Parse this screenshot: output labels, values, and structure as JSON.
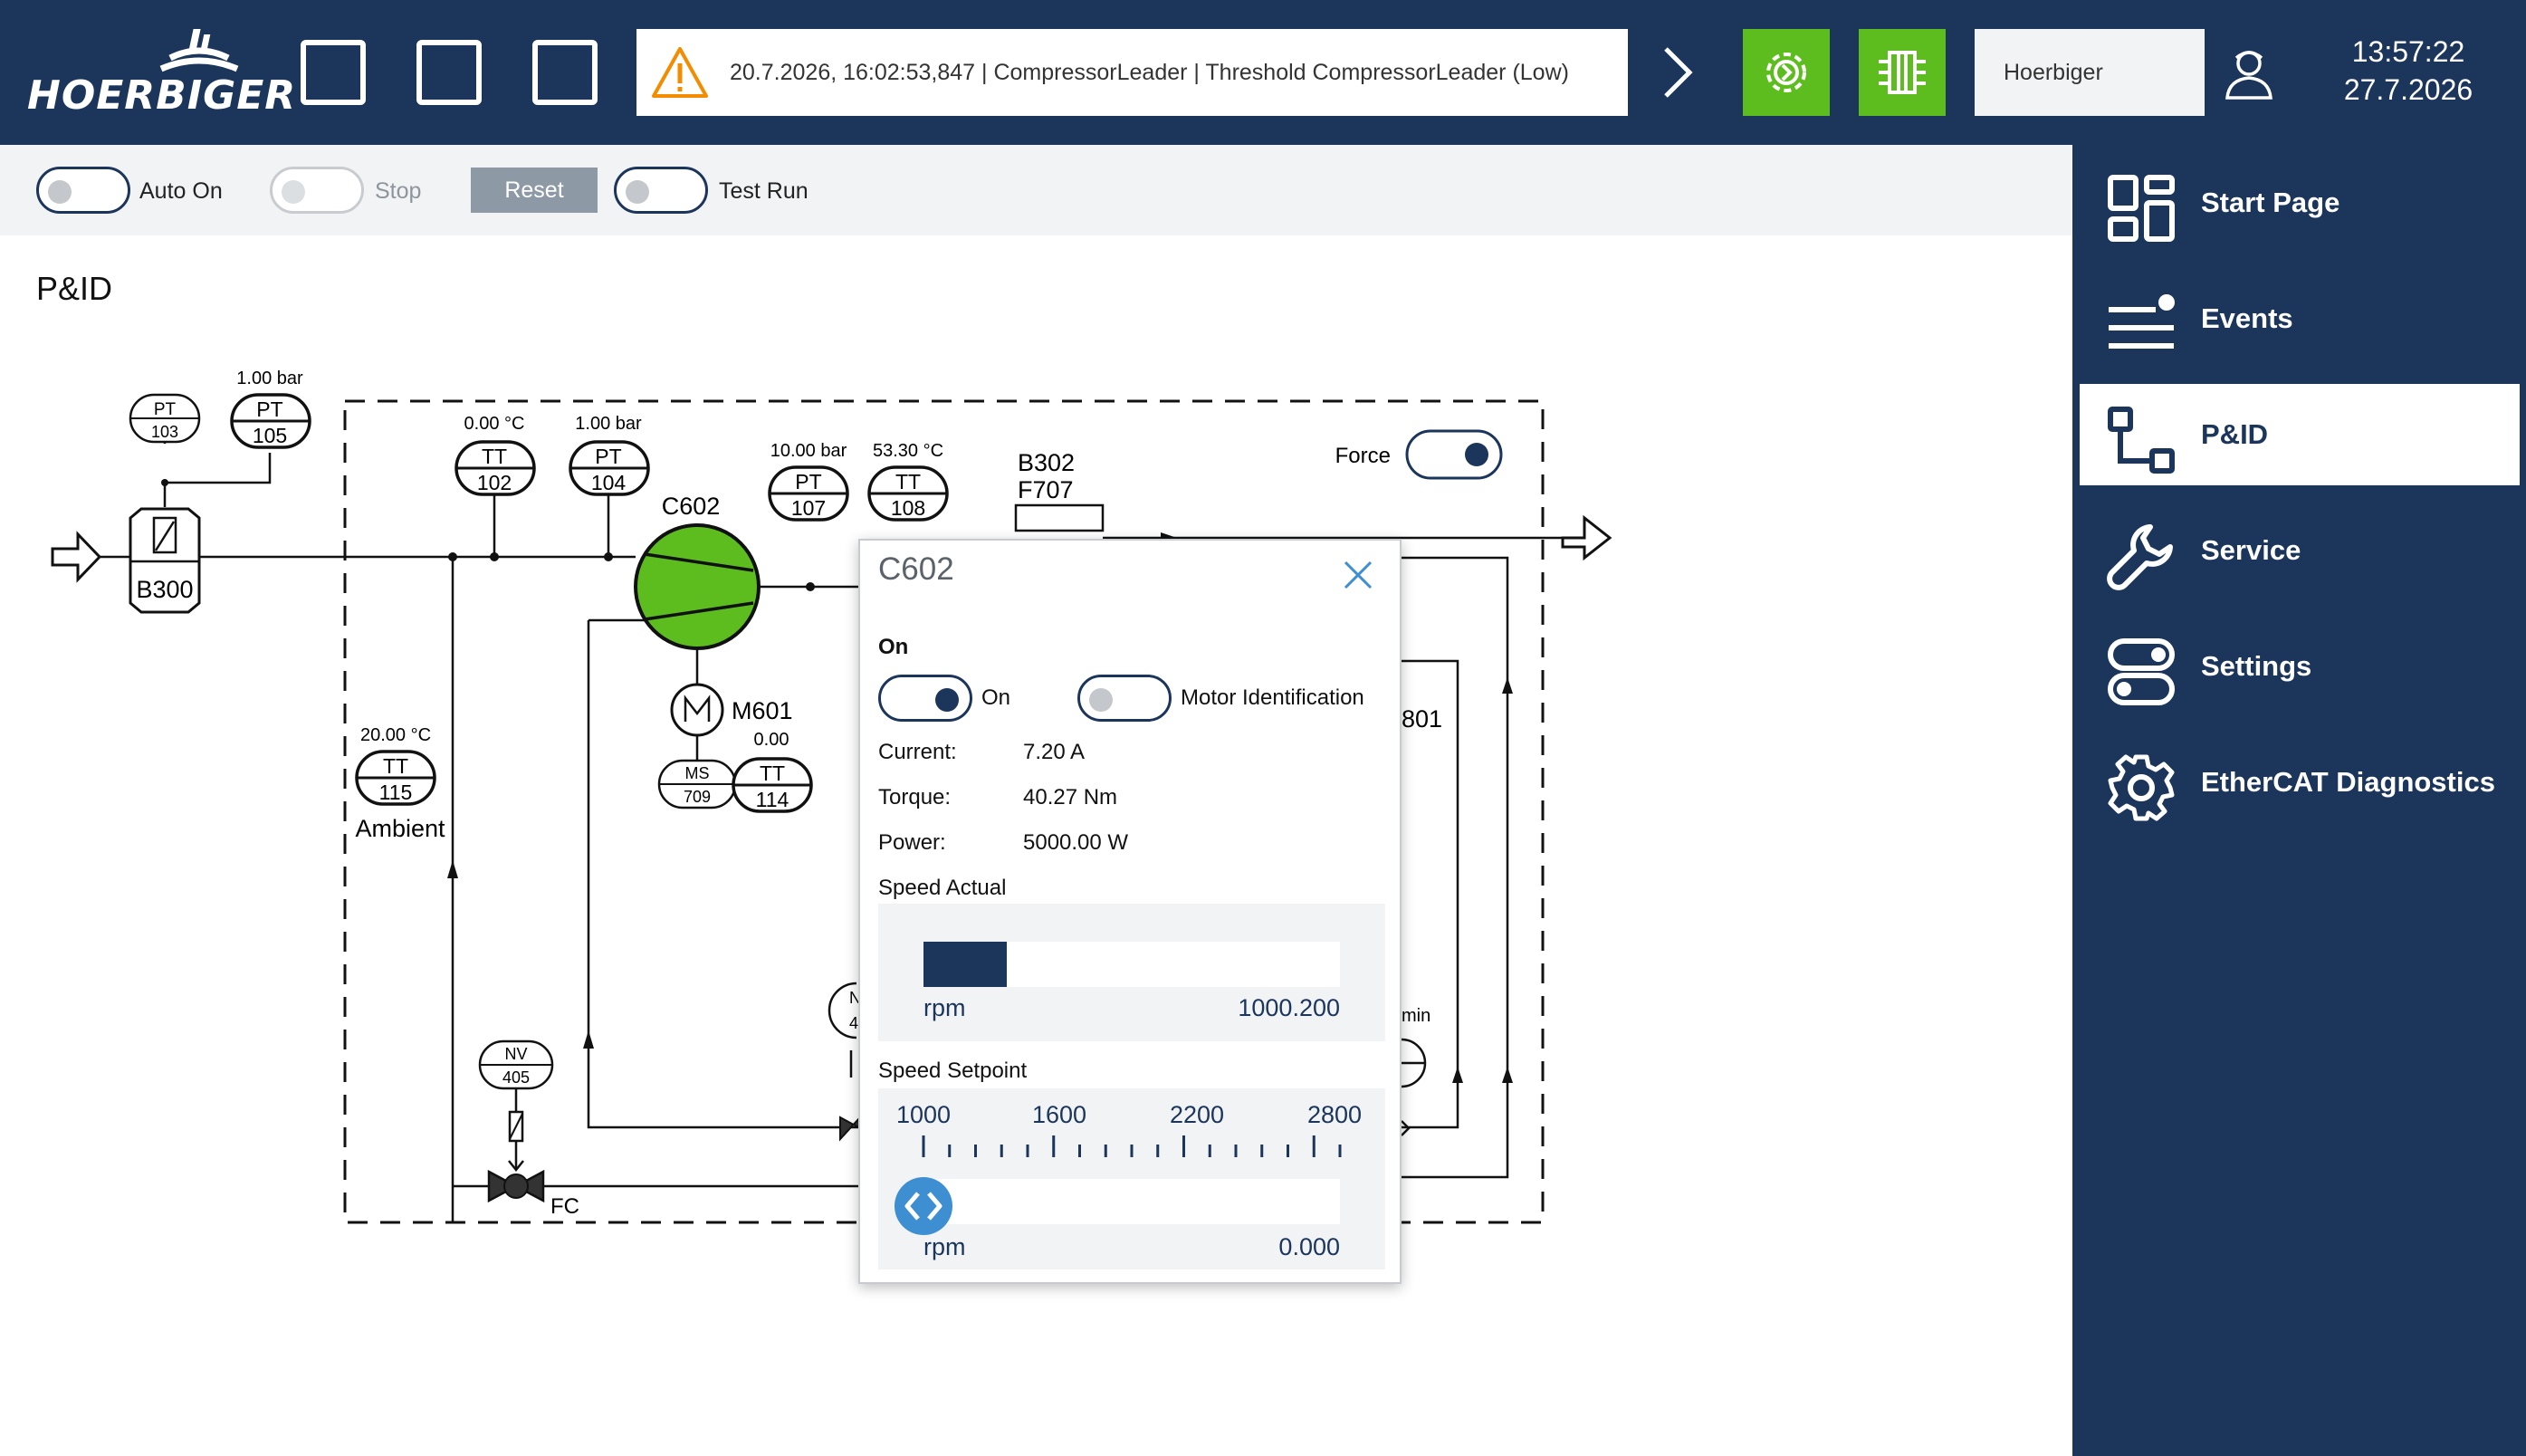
{
  "header": {
    "brand": "HOERBIGER",
    "alarm": {
      "text": "20.7.2026, 16:02:53,847 | CompressorLeader | Threshold CompressorLeader (Low)"
    },
    "user": "Hoerbiger",
    "time": "13:57:22",
    "date": "27.7.2026"
  },
  "controls": {
    "auto_on": {
      "label": "Auto On",
      "on": false
    },
    "stop": {
      "label": "Stop",
      "on": false,
      "disabled": true
    },
    "reset": {
      "label": "Reset"
    },
    "test_run": {
      "label": "Test Run",
      "on": false
    }
  },
  "page": {
    "title": "P&ID"
  },
  "sidebar": {
    "items": [
      {
        "label": "Start Page",
        "icon": "dashboard-icon"
      },
      {
        "label": "Events",
        "icon": "events-list-icon"
      },
      {
        "label": "P&ID",
        "icon": "pid-flow-icon",
        "active": true
      },
      {
        "label": "Service",
        "icon": "wrench-icon"
      },
      {
        "label": "Settings",
        "icon": "toggles-icon"
      },
      {
        "label": "EtherCAT Diagnostics",
        "icon": "gear-icon"
      }
    ]
  },
  "pid": {
    "pt103": {
      "tag": "PT",
      "num": "103"
    },
    "pt105": {
      "tag": "PT",
      "num": "105",
      "value": "1.00 bar"
    },
    "b300": "B300",
    "tt102": {
      "tag": "TT",
      "num": "102",
      "value": "0.00 °C"
    },
    "pt104": {
      "tag": "PT",
      "num": "104",
      "value": "1.00 bar"
    },
    "c602": "C602",
    "pt107": {
      "tag": "PT",
      "num": "107",
      "value": "10.00 bar"
    },
    "tt108": {
      "tag": "TT",
      "num": "108",
      "value": "53.30 °C"
    },
    "b302": "B302",
    "f707": "F707",
    "force": {
      "label": "Force",
      "on": true
    },
    "m601": "M601",
    "m601_value": "0.00",
    "ms709": {
      "tag": "MS",
      "num": "709"
    },
    "tt114": {
      "tag": "TT",
      "num": "114"
    },
    "tt115": {
      "tag": "TT",
      "num": "115",
      "value": "20.00 °C"
    },
    "ambient": "Ambient",
    "nv405": {
      "tag": "NV",
      "num": "405"
    },
    "fc": "FC",
    "partial_801": "801",
    "partial_min": "min",
    "partial_n": "N",
    "partial_4": "4"
  },
  "popup": {
    "title": "C602",
    "section_on": "On",
    "on_toggle": {
      "label": "On",
      "on": true
    },
    "motor_id_toggle": {
      "label": "Motor Identification",
      "on": false
    },
    "current": {
      "label": "Current:",
      "value": "7.20 A"
    },
    "torque": {
      "label": "Torque:",
      "value": "40.27 Nm"
    },
    "power": {
      "label": "Power:",
      "value": "5000.00 W"
    },
    "speed_actual": {
      "label": "Speed Actual",
      "unit": "rpm",
      "value": "1000.200",
      "fill_fraction": 0.2
    },
    "speed_setpoint": {
      "label": "Speed Setpoint",
      "ticks": [
        "1000",
        "1600",
        "2200",
        "2800"
      ],
      "unit": "rpm",
      "value": "0.000",
      "slider_value": 1000
    }
  },
  "colors": {
    "navy": "#1b355b",
    "green": "#5dbd1e",
    "alarm": "#f28c00"
  }
}
